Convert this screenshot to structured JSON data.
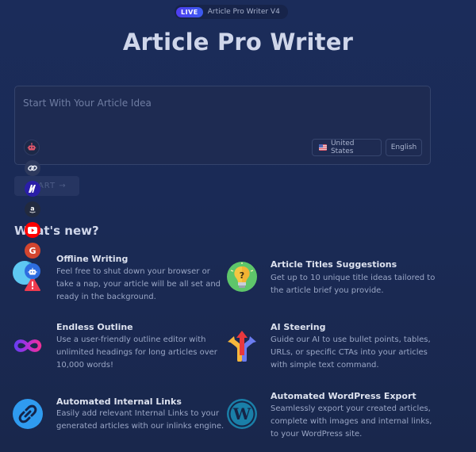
{
  "header": {
    "live_badge": "LIVE",
    "version_label": "Article Pro Writer V4",
    "title": "Article Pro Writer"
  },
  "prompt": {
    "placeholder": "Start With Your Article Idea",
    "value": "",
    "country": "United States",
    "language": "English",
    "start_label": "START →"
  },
  "whats_new": {
    "heading": "What's new?",
    "features": [
      {
        "title": "Offline Writing",
        "description": "Feel free to shut down your browser or take a nap, your article will be all set and ready in the background.",
        "icon": "globe-warning-icon"
      },
      {
        "title": "Article Titles Suggestions",
        "description": "Get up to 10 unique title ideas tailored to the article brief you provide.",
        "icon": "lightbulb-question-icon"
      },
      {
        "title": "Endless Outline",
        "description": "Use a user-friendly outline editor with unlimited headings for long articles over 10,000 words!",
        "icon": "infinity-icon"
      },
      {
        "title": "AI Steering",
        "description": "Guide our AI to use bullet points, tables, URLs, or specific CTAs into your articles with simple text command.",
        "icon": "split-arrows-icon"
      },
      {
        "title": "Automated Internal Links",
        "description": "Easily add relevant Internal Links to your generated articles with our inlinks engine.",
        "icon": "link-icon"
      },
      {
        "title": "Automated WordPress Export",
        "description": "Seamlessly export your created articles, complete with images and internal links, to your WordPress site.",
        "icon": "wordpress-icon"
      }
    ]
  },
  "icon_rail": [
    {
      "name": "robot-icon",
      "glyph": "🤖"
    },
    {
      "name": "chain-link-icon",
      "glyph": "∞"
    },
    {
      "name": "m-logo-icon",
      "glyph": "M"
    },
    {
      "name": "amazon-icon",
      "glyph": "a"
    },
    {
      "name": "youtube-icon",
      "glyph": "▶"
    },
    {
      "name": "google-icon",
      "glyph": "G"
    },
    {
      "name": "ai-bot-icon",
      "glyph": "☺"
    }
  ],
  "colors": {
    "background": "#1b2c5a",
    "card": "#1e2b52",
    "accent": "#4f3df0",
    "title_text": "#cfd6ea",
    "muted_text": "#9aa6c5"
  }
}
